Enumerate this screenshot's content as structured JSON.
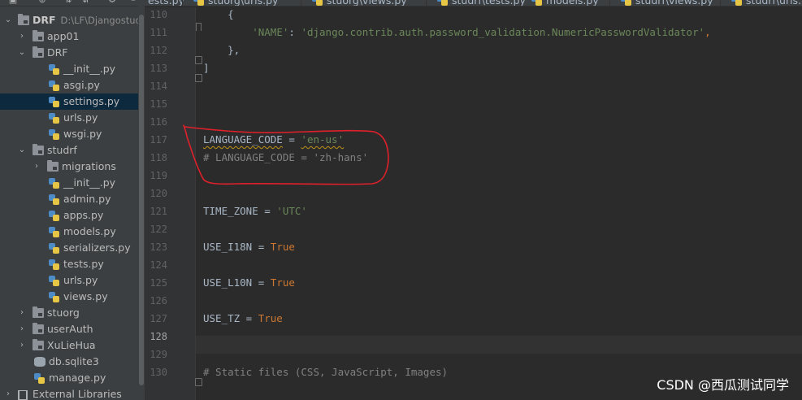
{
  "sidebar": {
    "project": {
      "name": "DRF",
      "path": "D:\\LF\\Djangostuda"
    },
    "items": [
      {
        "label": "app01",
        "type": "folder",
        "level": 1,
        "expanded": false
      },
      {
        "label": "DRF",
        "type": "folder",
        "level": 1,
        "expanded": true
      },
      {
        "label": "__init__.py",
        "type": "py",
        "level": 2
      },
      {
        "label": "asgi.py",
        "type": "py",
        "level": 2
      },
      {
        "label": "settings.py",
        "type": "py",
        "level": 2,
        "selected": true
      },
      {
        "label": "urls.py",
        "type": "py",
        "level": 2
      },
      {
        "label": "wsgi.py",
        "type": "py",
        "level": 2
      },
      {
        "label": "studrf",
        "type": "folder",
        "level": 1,
        "expanded": true
      },
      {
        "label": "migrations",
        "type": "folder",
        "level": 2,
        "expanded": false
      },
      {
        "label": "__init__.py",
        "type": "py",
        "level": 2
      },
      {
        "label": "admin.py",
        "type": "py",
        "level": 2
      },
      {
        "label": "apps.py",
        "type": "py",
        "level": 2
      },
      {
        "label": "models.py",
        "type": "py",
        "level": 2
      },
      {
        "label": "serializers.py",
        "type": "py",
        "level": 2
      },
      {
        "label": "tests.py",
        "type": "py",
        "level": 2
      },
      {
        "label": "urls.py",
        "type": "py",
        "level": 2
      },
      {
        "label": "views.py",
        "type": "py",
        "level": 2
      },
      {
        "label": "stuorg",
        "type": "folder",
        "level": 1,
        "expanded": false
      },
      {
        "label": "userAuth",
        "type": "folder",
        "level": 1,
        "expanded": false
      },
      {
        "label": "XuLieHua",
        "type": "folder",
        "level": 1,
        "expanded": false
      },
      {
        "label": "db.sqlite3",
        "type": "db",
        "level": 1
      },
      {
        "label": "manage.py",
        "type": "py",
        "level": 1
      }
    ],
    "external": "External Libraries"
  },
  "tabs": [
    {
      "label": "ests.py",
      "icon": false
    },
    {
      "label": "stuorg\\urls.py",
      "icon": true
    },
    {
      "label": "stuorg\\views.py",
      "icon": true
    },
    {
      "label": "studrf\\tests.py",
      "icon": true
    },
    {
      "label": "models.py",
      "icon": true
    },
    {
      "label": "studrf\\views.py",
      "icon": true
    },
    {
      "label": "studrf\\urls.py",
      "icon": true
    }
  ],
  "editor": {
    "current_line": "128",
    "lines": [
      {
        "n": "110",
        "tokens": [
          {
            "t": "    {",
            "c": ""
          }
        ]
      },
      {
        "n": "111",
        "tokens": [
          {
            "t": "        ",
            "c": ""
          },
          {
            "t": "'NAME'",
            "c": "str"
          },
          {
            "t": ": ",
            "c": ""
          },
          {
            "t": "'django.contrib.auth.password_validation.NumericPasswordValidator'",
            "c": "str"
          },
          {
            "t": ",",
            "c": "kw"
          }
        ]
      },
      {
        "n": "112",
        "tokens": [
          {
            "t": "    },",
            "c": ""
          }
        ]
      },
      {
        "n": "113",
        "tokens": [
          {
            "t": "]",
            "c": ""
          }
        ]
      },
      {
        "n": "114",
        "tokens": []
      },
      {
        "n": "115",
        "tokens": []
      },
      {
        "n": "116",
        "tokens": []
      },
      {
        "n": "117",
        "tokens": [
          {
            "t": "LANGUAGE_CODE",
            "c": "squiggle"
          },
          {
            "t": " = ",
            "c": ""
          },
          {
            "t": "'en-us'",
            "c": "str squiggle"
          }
        ]
      },
      {
        "n": "118",
        "tokens": [
          {
            "t": "# LANGUAGE_CODE = 'zh-hans'",
            "c": "cmt"
          }
        ]
      },
      {
        "n": "119",
        "tokens": []
      },
      {
        "n": "120",
        "tokens": []
      },
      {
        "n": "121",
        "tokens": [
          {
            "t": "TIME_ZONE = ",
            "c": ""
          },
          {
            "t": "'UTC'",
            "c": "str"
          }
        ]
      },
      {
        "n": "122",
        "tokens": []
      },
      {
        "n": "123",
        "tokens": [
          {
            "t": "USE_I18N = ",
            "c": ""
          },
          {
            "t": "True",
            "c": "kw"
          }
        ]
      },
      {
        "n": "124",
        "tokens": []
      },
      {
        "n": "125",
        "tokens": [
          {
            "t": "USE_L10N = ",
            "c": ""
          },
          {
            "t": "True",
            "c": "kw"
          }
        ]
      },
      {
        "n": "126",
        "tokens": []
      },
      {
        "n": "127",
        "tokens": [
          {
            "t": "USE_TZ = ",
            "c": ""
          },
          {
            "t": "True",
            "c": "kw"
          }
        ]
      },
      {
        "n": "128",
        "tokens": []
      },
      {
        "n": "129",
        "tokens": []
      },
      {
        "n": "130",
        "tokens": [
          {
            "t": "# Static files (CSS, JavaScript, Images)",
            "c": "cmt"
          }
        ]
      }
    ]
  },
  "watermark": "CSDN @西瓜测试同学",
  "colors": {
    "background": "#2b2b2b",
    "sidebar": "#3c3f41",
    "selection": "#0d293e",
    "string": "#6a8759",
    "keyword": "#cc7832",
    "comment": "#808080",
    "annotation": "#e0202a"
  }
}
